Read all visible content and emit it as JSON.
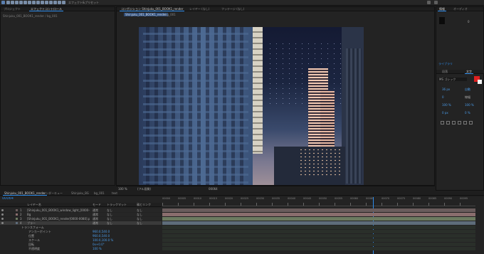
{
  "toolbar": {
    "workspace_label": "エフェクト&プリセット",
    "tool_icons": [
      "home-icon",
      "selection-icon",
      "hand-icon",
      "zoom-icon",
      "rotate-icon",
      "camera-icon",
      "pan-behind-icon",
      "rectangle-icon",
      "pen-icon",
      "text-icon",
      "brush-icon",
      "clone-icon",
      "eraser-icon",
      "roto-icon",
      "puppet-icon"
    ]
  },
  "project": {
    "tab_label": "プロジェクト",
    "tab2_label": "エフェクトコントロール",
    "subtitle": "Shinjuku_001_BOOK1_render / bg_001"
  },
  "viewer": {
    "tab_label": "コンポジション Shinjuku_001_BOOK1_render",
    "tab2_label": "レイヤー (なし)",
    "tab3_label": "フッテージ (なし)",
    "comp_chip": "Shinjuku_001_BOOK1_render",
    "sub_chip": "bg_001",
    "zoom": "100 %",
    "resolution": "(フル画質)",
    "timecode": "00064"
  },
  "right_panel": {
    "info_tab": "情報",
    "audio_tab": "オーディオ",
    "char_header": "ライブラリ",
    "para_tab": "段落",
    "char_tab": "文字",
    "font": "MS ゴシック",
    "size_value": "36 px",
    "leading": "自動",
    "tracking": "0",
    "stroke": "線幅",
    "accent_color": "#e02020",
    "values": [
      "0",
      "100 %",
      "100 %",
      "0 px",
      "0 %",
      "0 %"
    ]
  },
  "timeline": {
    "tabs": [
      "Shinjuku_001_BOOK1_render",
      "レンダーキュー",
      "Shinjuku_BG",
      "bg_001",
      "text"
    ],
    "timecode": "00064",
    "header": {
      "layer_name": "レイヤー名",
      "mode": "モード",
      "trkmat": "トラックマット",
      "parent": "親とリンク"
    },
    "layers": [
      {
        "num": "1",
        "name": "[Shinjuku_001_BOOK1_window_light_[0000-0080].png]",
        "mode": "通常",
        "trk": "なし",
        "parent": "なし",
        "color": "#6a5c5c"
      },
      {
        "num": "2",
        "name": "Bg",
        "mode": "通常",
        "trk": "なし",
        "parent": "なし",
        "color": "#8a6d6d"
      },
      {
        "num": "3",
        "name": "[Shinjuku_001_BOOK1_render[0000-0080].png]",
        "mode": "通常",
        "trk": "なし",
        "parent": "なし",
        "color": "#6c7a60"
      },
      {
        "num": "4",
        "name": "ブラー",
        "mode": "通常",
        "trk": "なし",
        "parent": "なし",
        "color": "#5e6c7a"
      }
    ],
    "props": [
      {
        "name": "トランスフォーム",
        "value": ""
      },
      {
        "name": "アンカーポイント",
        "value": "960.0,540.0"
      },
      {
        "name": "位置",
        "value": "960.0,540.0"
      },
      {
        "name": "スケール",
        "value": "100.0,100.0 %"
      },
      {
        "name": "回転",
        "value": "0x+0.0°"
      },
      {
        "name": "不透明度",
        "value": "100 %"
      }
    ],
    "ruler": [
      "00000",
      "00005",
      "00010",
      "00015",
      "00020",
      "00025",
      "00030",
      "00035",
      "00040",
      "00045",
      "00050",
      "00055",
      "00060",
      "00065",
      "00070",
      "00075",
      "00080",
      "00085",
      "00090",
      "00095"
    ],
    "playhead_frame": 64,
    "total_frames": 95
  }
}
